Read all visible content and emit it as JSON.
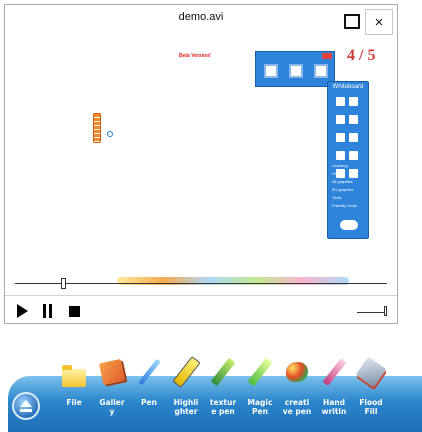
{
  "window": {
    "title": "demo.avi",
    "maximize_icon": "maximize-icon",
    "close_glyph": "×"
  },
  "video": {
    "demo_text": "Beta Version!",
    "page_counter": "4 / 5",
    "whiteboard_title": "Whiteboard",
    "whiteboard_items": [
      "Learning",
      "Pen",
      "All graphics",
      "3D graphics",
      "Tools",
      "Friendly Tools"
    ]
  },
  "player": {
    "seek_position": 0.12,
    "volume_level": 0.9
  },
  "dock": {
    "accent": "#2c86cc",
    "items": [
      {
        "label": "File",
        "icon": "folder-icon"
      },
      {
        "label": "Galler\ny",
        "icon": "gallery-books-icon"
      },
      {
        "label": "Pen",
        "icon": "pen-icon"
      },
      {
        "label": "Highli\nghter",
        "icon": "highlighter-icon"
      },
      {
        "label": "textur\ne pen",
        "icon": "texture-pen-icon"
      },
      {
        "label": "Magic\nPen",
        "icon": "magic-pen-icon"
      },
      {
        "label": "creati\nve pen",
        "icon": "creative-pen-icon"
      },
      {
        "label": "Hand\nwritin",
        "icon": "handwriting-icon"
      },
      {
        "label": "Flood\nFill",
        "icon": "flood-fill-icon"
      }
    ]
  }
}
